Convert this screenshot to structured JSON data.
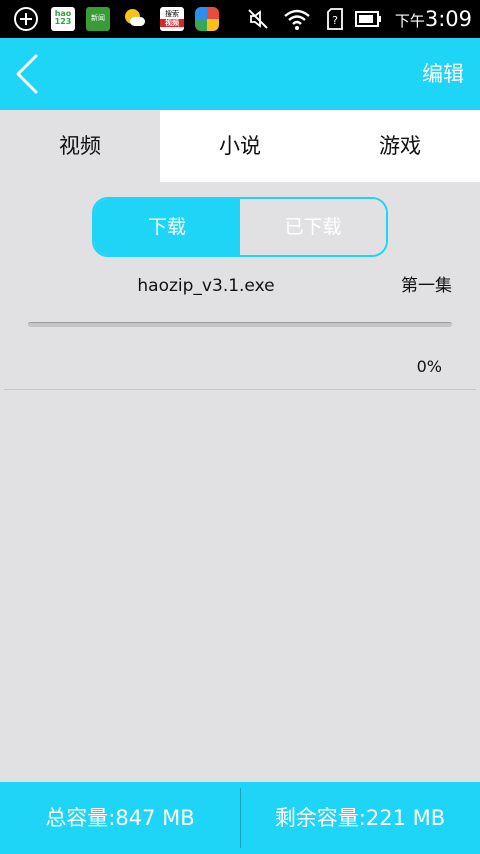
{
  "status_bar": {
    "app_icons": [
      "add-icon",
      "hao123-app-icon",
      "news-app-icon",
      "weather-app-icon",
      "video-search-app-icon",
      "game-center-app-icon"
    ],
    "hao123_label": "hao\n123",
    "news_label": "新闻",
    "video_label_top": "搜索",
    "video_label_bottom": "视频",
    "system_icons": [
      "mute-icon",
      "wifi-icon",
      "sim-unknown-icon",
      "battery-icon"
    ],
    "time_period": "下午",
    "time": "3:09"
  },
  "header": {
    "back_icon": "chevron-left-icon",
    "edit_label": "编辑"
  },
  "tabs": [
    {
      "label": "视频",
      "active": true
    },
    {
      "label": "小说",
      "active": false
    },
    {
      "label": "游戏",
      "active": false
    }
  ],
  "segment": {
    "download_label": "下载",
    "downloaded_label": "已下载",
    "selected": "下载"
  },
  "downloads": [
    {
      "file_name": "haozip_v3.1.exe",
      "episode": "第一集",
      "progress_percent": 0,
      "progress_text": "0%"
    }
  ],
  "footer": {
    "total_capacity": "总容量:847 MB",
    "remaining_capacity": "剩余容量:221 MB"
  },
  "colors": {
    "accent": "#1ed4f7",
    "background": "#e1e1e3",
    "status_bar": "#000000"
  }
}
